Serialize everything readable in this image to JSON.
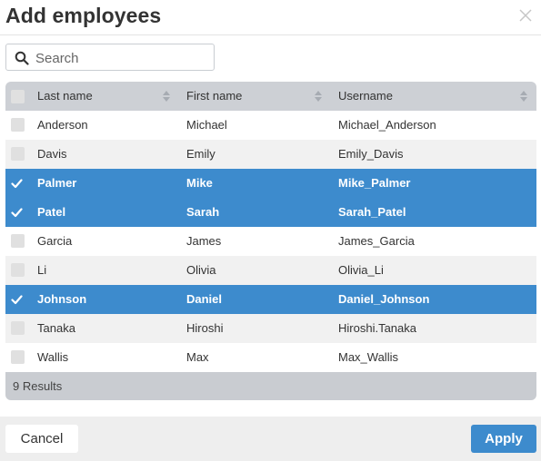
{
  "dialog": {
    "title": "Add employees"
  },
  "search": {
    "placeholder": "Search"
  },
  "table": {
    "columns": [
      "Last name",
      "First name",
      "Username"
    ],
    "rows": [
      {
        "last": "Anderson",
        "first": "Michael",
        "user": "Michael_Anderson",
        "selected": false
      },
      {
        "last": "Davis",
        "first": "Emily",
        "user": "Emily_Davis",
        "selected": false
      },
      {
        "last": "Palmer",
        "first": "Mike",
        "user": "Mike_Palmer",
        "selected": true
      },
      {
        "last": "Patel",
        "first": "Sarah",
        "user": "Sarah_Patel",
        "selected": true
      },
      {
        "last": "Garcia",
        "first": "James",
        "user": "James_Garcia",
        "selected": false
      },
      {
        "last": "Li",
        "first": "Olivia",
        "user": "Olivia_Li",
        "selected": false
      },
      {
        "last": "Johnson",
        "first": "Daniel",
        "user": "Daniel_Johnson",
        "selected": true
      },
      {
        "last": "Tanaka",
        "first": "Hiroshi",
        "user": "Hiroshi.Tanaka",
        "selected": false
      },
      {
        "last": "Wallis",
        "first": "Max",
        "user": "Max_Wallis",
        "selected": false
      }
    ],
    "results": "9 Results"
  },
  "buttons": {
    "cancel": "Cancel",
    "apply": "Apply"
  },
  "colors": {
    "accent": "#3d8bcd",
    "header_bg": "#cdd0d5",
    "stripe": "#f1f1f1"
  },
  "icons": {
    "close": "close-icon",
    "search": "search-icon",
    "sort": "sort-icon",
    "check": "check-icon"
  }
}
